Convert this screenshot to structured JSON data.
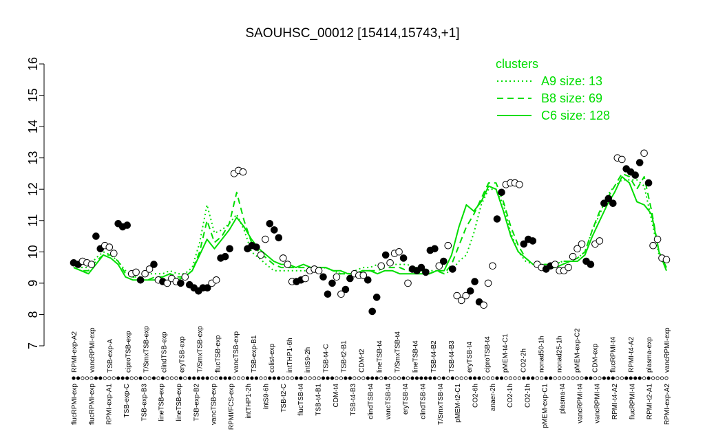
{
  "chart_data": {
    "type": "line",
    "title": "SAOUHSC_00012 [15414,15743,+1]",
    "xlabel": "",
    "ylabel": "",
    "ylim": [
      7,
      16
    ],
    "yticks": [
      "7",
      "8",
      "9",
      "10",
      "11",
      "12",
      "13",
      "14",
      "15",
      "16"
    ],
    "grid": false,
    "legend_position": "top-right",
    "legend": {
      "title": "clusters",
      "entries": [
        {
          "label": "A9 size: 13",
          "style": "dotted"
        },
        {
          "label": "B8 size: 69",
          "style": "dashed"
        },
        {
          "label": "C6 size: 128",
          "style": "solid"
        }
      ]
    },
    "colors": {
      "cluster_lines": "#00dd00",
      "filled_point": "#000000",
      "open_point": "#ffffff"
    },
    "x_tick_labels_top": [
      "RPMI-exp-A2",
      "vancRPMI-exp",
      "TSB-exp-A",
      "ciproTSB-exp",
      "T/SmxTSB-exp",
      "clindTSB-exp",
      "eryTSB-exp",
      "T/SmxTSB-exp",
      "flucTSB-exp",
      "vancTSB-exp",
      "TSB-exp-B1",
      "colist-exp",
      "intTHP1-6h",
      "intS9-2h",
      "TSB-t4-C",
      "TSB-t2-B1",
      "CDM-t2",
      "lineTSB-t4",
      "T/SmxTSB-t4",
      "lineTSB-t4",
      "TSB-t4-B2",
      "TSB-t4-B3",
      "eryTSB-t4",
      "ciproTSB-t4",
      "pMEM-t4-C1",
      "CO2-2h",
      "nonad50-1h",
      "nonad25-1h",
      "pMEM-exp-C2",
      "CDM-exp",
      "flucRPMI-t4",
      "RPMI-t4-A2",
      "plasma-exp",
      "vancRPMI-exp"
    ],
    "x_tick_labels_bottom": [
      "flucRPMI-exp",
      "flucRPMI-exp",
      "RPMI-exp-A1",
      "TSB-exp-C",
      "TSB-exp-B3",
      "lineTSB-exp",
      "lineTSB-exp",
      "TSB-exp-B2",
      "vancTSB-exp",
      "RPMI/FCS-exp",
      "intTHP1-2h",
      "intS9-6h",
      "TSB-t2-C",
      "flucTSB-t4",
      "TSB-t4-B1",
      "CDM-t4",
      "TSB-t4-B3",
      "clindTSB-t4",
      "vancTSB-t4",
      "eryTSB-t4",
      "clindTSB-t4",
      "T/SmxTSB-t4",
      "pMEM-t2-C1",
      "CO2-6h",
      "anaer-2h",
      "CO2-1h",
      "CO2-1h",
      "pMEM-exp-C1",
      "plasma-t4",
      "vancRPMI-t4",
      "vancRPMI-t4",
      "RPMI-t4-A2",
      "flucRPMI-t4",
      "RPMI-t2-A1",
      "RPMI-exp-A2"
    ],
    "series": [
      {
        "name": "A9 size: 13",
        "style": "dotted",
        "values": [
          9.6,
          9.5,
          9.5,
          9.8,
          10.0,
          9.9,
          9.7,
          9.4,
          9.2,
          9.2,
          9.3,
          9.3,
          9.3,
          9.4,
          9.3,
          9.3,
          9.5,
          10.3,
          11.5,
          10.6,
          10.7,
          10.9,
          11.2,
          10.7,
          10.0,
          9.8,
          9.6,
          9.4,
          9.4,
          9.4,
          9.4,
          9.4,
          9.4,
          9.4,
          9.5,
          9.4,
          9.3,
          9.3,
          9.4,
          9.5,
          9.5,
          9.6,
          9.6,
          9.6,
          9.6,
          9.6,
          9.5,
          9.5,
          9.4,
          9.4,
          9.3,
          9.4,
          9.7,
          9.9,
          10.6,
          11.5,
          12.0,
          12.0,
          11.5,
          10.6,
          10.0,
          9.7,
          9.6,
          9.6,
          9.6,
          9.6,
          9.7,
          9.7,
          9.8,
          10.0,
          10.7,
          11.2,
          11.8,
          12.1,
          12.3,
          12.3,
          12.3,
          12.1,
          11.0,
          9.9,
          9.5
        ]
      },
      {
        "name": "B8 size: 69",
        "style": "dashed",
        "values": [
          9.5,
          9.4,
          9.4,
          9.7,
          9.9,
          9.9,
          9.7,
          9.3,
          9.2,
          9.1,
          9.1,
          9.2,
          9.2,
          9.3,
          9.2,
          9.2,
          9.4,
          10.0,
          11.0,
          10.3,
          10.5,
          10.9,
          11.9,
          11.0,
          10.3,
          10.0,
          9.8,
          9.6,
          9.5,
          9.5,
          9.5,
          9.5,
          9.5,
          9.5,
          9.5,
          9.4,
          9.3,
          9.3,
          9.3,
          9.4,
          9.4,
          9.4,
          9.5,
          9.5,
          9.5,
          9.4,
          9.4,
          9.4,
          9.3,
          9.4,
          9.3,
          9.6,
          10.2,
          10.8,
          11.2,
          11.7,
          12.2,
          12.2,
          11.6,
          10.8,
          10.2,
          9.8,
          9.6,
          9.6,
          9.6,
          9.6,
          9.7,
          9.7,
          9.8,
          10.0,
          10.7,
          11.3,
          11.7,
          12.1,
          12.5,
          12.4,
          12.0,
          12.4,
          11.3,
          10.0,
          9.5
        ]
      },
      {
        "name": "C6 size: 128",
        "style": "solid",
        "values": [
          9.5,
          9.4,
          9.3,
          9.6,
          9.9,
          9.8,
          9.6,
          9.2,
          9.1,
          9.1,
          9.1,
          9.1,
          9.2,
          9.3,
          9.1,
          9.2,
          9.4,
          9.9,
          10.4,
          10.1,
          10.4,
          10.7,
          11.1,
          10.8,
          10.4,
          10.1,
          9.9,
          9.7,
          9.6,
          9.6,
          9.5,
          9.6,
          9.5,
          9.5,
          9.5,
          9.4,
          9.4,
          9.3,
          9.3,
          9.4,
          9.4,
          9.3,
          9.4,
          9.4,
          9.3,
          9.3,
          9.3,
          9.3,
          9.3,
          9.4,
          9.4,
          9.9,
          10.8,
          11.5,
          11.3,
          11.6,
          12.1,
          12.0,
          11.3,
          10.5,
          10.0,
          9.8,
          9.6,
          9.5,
          9.5,
          9.5,
          9.6,
          9.7,
          9.7,
          9.9,
          10.5,
          11.0,
          11.5,
          11.9,
          12.4,
          12.2,
          11.6,
          11.5,
          11.2,
          10.0,
          9.4
        ]
      }
    ],
    "points": [
      {
        "y": 9.65,
        "filled": true
      },
      {
        "y": 9.6,
        "filled": true
      },
      {
        "y": 9.7,
        "filled": false
      },
      {
        "y": 9.65,
        "filled": false
      },
      {
        "y": 9.6,
        "filled": false
      },
      {
        "y": 10.5,
        "filled": true
      },
      {
        "y": 10.1,
        "filled": true
      },
      {
        "y": 10.2,
        "filled": false
      },
      {
        "y": 10.15,
        "filled": false
      },
      {
        "y": 9.95,
        "filled": false
      },
      {
        "y": 10.9,
        "filled": true
      },
      {
        "y": 10.8,
        "filled": true
      },
      {
        "y": 10.85,
        "filled": true
      },
      {
        "y": 9.3,
        "filled": false
      },
      {
        "y": 9.35,
        "filled": false
      },
      {
        "y": 9.1,
        "filled": true
      },
      {
        "y": 9.3,
        "filled": false
      },
      {
        "y": 9.45,
        "filled": false
      },
      {
        "y": 9.6,
        "filled": true
      },
      {
        "y": 9.1,
        "filled": false
      },
      {
        "y": 9.05,
        "filled": true
      },
      {
        "y": 9.0,
        "filled": false
      },
      {
        "y": 9.15,
        "filled": false
      },
      {
        "y": 9.05,
        "filled": false
      },
      {
        "y": 9.0,
        "filled": true
      },
      {
        "y": 9.2,
        "filled": false
      },
      {
        "y": 8.95,
        "filled": true
      },
      {
        "y": 8.85,
        "filled": true
      },
      {
        "y": 8.75,
        "filled": true
      },
      {
        "y": 8.85,
        "filled": true
      },
      {
        "y": 8.85,
        "filled": true
      },
      {
        "y": 9.0,
        "filled": false
      },
      {
        "y": 9.1,
        "filled": false
      },
      {
        "y": 9.8,
        "filled": true
      },
      {
        "y": 9.85,
        "filled": true
      },
      {
        "y": 10.1,
        "filled": true
      },
      {
        "y": 12.5,
        "filled": false
      },
      {
        "y": 12.6,
        "filled": false
      },
      {
        "y": 12.55,
        "filled": false
      },
      {
        "y": 10.1,
        "filled": true
      },
      {
        "y": 10.2,
        "filled": true
      },
      {
        "y": 10.15,
        "filled": true
      },
      {
        "y": 9.9,
        "filled": false
      },
      {
        "y": 10.4,
        "filled": false
      },
      {
        "y": 10.9,
        "filled": true
      },
      {
        "y": 10.7,
        "filled": true
      },
      {
        "y": 10.45,
        "filled": true
      },
      {
        "y": 9.8,
        "filled": false
      },
      {
        "y": 9.6,
        "filled": false
      },
      {
        "y": 9.05,
        "filled": false
      },
      {
        "y": 9.05,
        "filled": true
      },
      {
        "y": 9.1,
        "filled": true
      },
      {
        "y": 9.15,
        "filled": false
      },
      {
        "y": 9.4,
        "filled": false
      },
      {
        "y": 9.45,
        "filled": false
      },
      {
        "y": 9.4,
        "filled": false
      },
      {
        "y": 9.2,
        "filled": true
      },
      {
        "y": 8.65,
        "filled": true
      },
      {
        "y": 9.0,
        "filled": true
      },
      {
        "y": 9.2,
        "filled": false
      },
      {
        "y": 8.65,
        "filled": false
      },
      {
        "y": 8.8,
        "filled": true
      },
      {
        "y": 9.15,
        "filled": true
      },
      {
        "y": 9.3,
        "filled": false
      },
      {
        "y": 9.25,
        "filled": false
      },
      {
        "y": 9.25,
        "filled": false
      },
      {
        "y": 9.1,
        "filled": true
      },
      {
        "y": 8.1,
        "filled": true
      },
      {
        "y": 8.55,
        "filled": true
      },
      {
        "y": 9.55,
        "filled": false
      },
      {
        "y": 9.9,
        "filled": true
      },
      {
        "y": 9.65,
        "filled": false
      },
      {
        "y": 9.95,
        "filled": false
      },
      {
        "y": 10.0,
        "filled": false
      },
      {
        "y": 9.8,
        "filled": true
      },
      {
        "y": 9.0,
        "filled": false
      },
      {
        "y": 9.45,
        "filled": true
      },
      {
        "y": 9.4,
        "filled": true
      },
      {
        "y": 9.5,
        "filled": true
      },
      {
        "y": 9.35,
        "filled": true
      },
      {
        "y": 10.05,
        "filled": true
      },
      {
        "y": 10.1,
        "filled": true
      },
      {
        "y": 9.55,
        "filled": false
      },
      {
        "y": 9.7,
        "filled": true
      },
      {
        "y": 10.2,
        "filled": false
      },
      {
        "y": 9.45,
        "filled": true
      },
      {
        "y": 8.6,
        "filled": false
      },
      {
        "y": 8.45,
        "filled": false
      },
      {
        "y": 8.6,
        "filled": false
      },
      {
        "y": 8.75,
        "filled": true
      },
      {
        "y": 9.05,
        "filled": true
      },
      {
        "y": 8.4,
        "filled": true
      },
      {
        "y": 8.3,
        "filled": false
      },
      {
        "y": 9.0,
        "filled": false
      },
      {
        "y": 9.55,
        "filled": false
      },
      {
        "y": 11.05,
        "filled": true
      },
      {
        "y": 11.9,
        "filled": true
      },
      {
        "y": 12.15,
        "filled": false
      },
      {
        "y": 12.2,
        "filled": false
      },
      {
        "y": 12.2,
        "filled": false
      },
      {
        "y": 12.15,
        "filled": false
      },
      {
        "y": 10.25,
        "filled": true
      },
      {
        "y": 10.4,
        "filled": true
      },
      {
        "y": 10.35,
        "filled": true
      },
      {
        "y": 9.6,
        "filled": false
      },
      {
        "y": 9.5,
        "filled": false
      },
      {
        "y": 9.45,
        "filled": true
      },
      {
        "y": 9.55,
        "filled": true
      },
      {
        "y": 9.6,
        "filled": false
      },
      {
        "y": 9.4,
        "filled": false
      },
      {
        "y": 9.4,
        "filled": false
      },
      {
        "y": 9.5,
        "filled": false
      },
      {
        "y": 9.85,
        "filled": false
      },
      {
        "y": 10.1,
        "filled": false
      },
      {
        "y": 10.25,
        "filled": false
      },
      {
        "y": 9.7,
        "filled": true
      },
      {
        "y": 9.6,
        "filled": true
      },
      {
        "y": 10.25,
        "filled": false
      },
      {
        "y": 10.35,
        "filled": false
      },
      {
        "y": 11.55,
        "filled": true
      },
      {
        "y": 11.7,
        "filled": true
      },
      {
        "y": 11.55,
        "filled": true
      },
      {
        "y": 13.0,
        "filled": false
      },
      {
        "y": 12.95,
        "filled": false
      },
      {
        "y": 12.65,
        "filled": true
      },
      {
        "y": 12.55,
        "filled": true
      },
      {
        "y": 12.45,
        "filled": true
      },
      {
        "y": 12.85,
        "filled": true
      },
      {
        "y": 13.15,
        "filled": false
      },
      {
        "y": 12.2,
        "filled": true
      },
      {
        "y": 10.2,
        "filled": false
      },
      {
        "y": 10.4,
        "filled": false
      },
      {
        "y": 9.8,
        "filled": false
      },
      {
        "y": 9.75,
        "filled": false
      }
    ]
  }
}
